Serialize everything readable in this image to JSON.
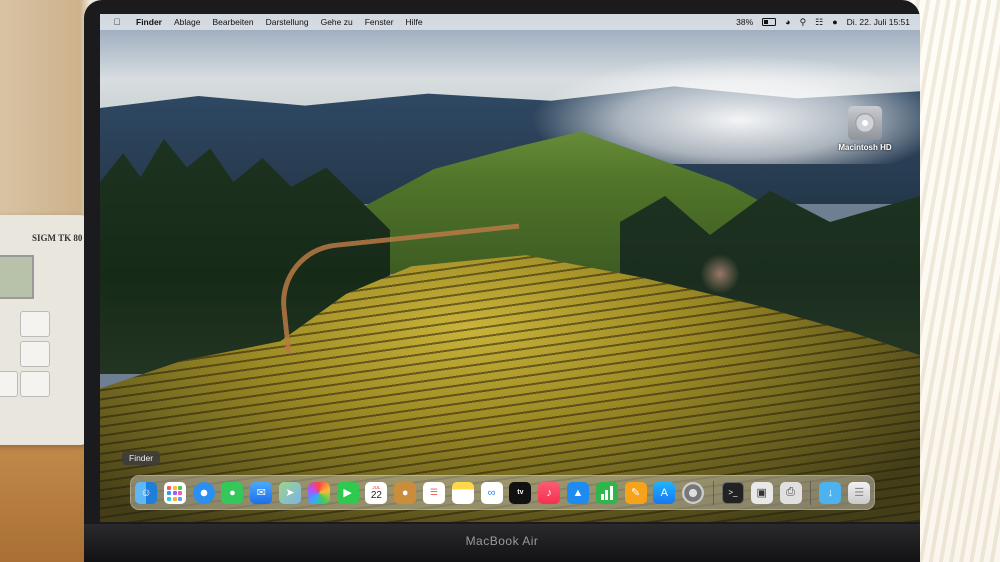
{
  "menubar": {
    "apple_icon": "apple-logo-icon",
    "app_name": "Finder",
    "menus": [
      "Ablage",
      "Bearbeiten",
      "Darstellung",
      "Gehe zu",
      "Fenster",
      "Hilfe"
    ],
    "battery_percent": "38%",
    "date_time": "Di. 22. Juli 15:51"
  },
  "desktop": {
    "drive_label": "Macintosh HD"
  },
  "dock": {
    "tooltip": "Finder",
    "apps": [
      {
        "name": "Finder",
        "icon": "finder-icon"
      },
      {
        "name": "Launchpad",
        "icon": "launchpad-icon"
      },
      {
        "name": "Safari",
        "icon": "safari-icon"
      },
      {
        "name": "Messages",
        "icon": "messages-icon"
      },
      {
        "name": "Mail",
        "icon": "mail-icon"
      },
      {
        "name": "Maps",
        "icon": "maps-icon"
      },
      {
        "name": "Photos",
        "icon": "photos-icon"
      },
      {
        "name": "FaceTime",
        "icon": "facetime-icon"
      },
      {
        "name": "Calendar",
        "icon": "calendar-icon"
      },
      {
        "name": "Contacts",
        "icon": "contacts-icon"
      },
      {
        "name": "Reminders",
        "icon": "reminders-icon"
      },
      {
        "name": "Notes",
        "icon": "notes-icon"
      },
      {
        "name": "Freeform",
        "icon": "freeform-icon"
      },
      {
        "name": "TV",
        "icon": "tv-icon"
      },
      {
        "name": "Music",
        "icon": "music-icon"
      },
      {
        "name": "Keynote",
        "icon": "keynote-icon"
      },
      {
        "name": "Numbers",
        "icon": "numbers-icon"
      },
      {
        "name": "Pages",
        "icon": "pages-icon"
      },
      {
        "name": "App Store",
        "icon": "app-store-icon"
      },
      {
        "name": "System Settings",
        "icon": "system-settings-icon"
      }
    ],
    "calendar_month": "JUL",
    "calendar_day": "22",
    "tv_label": "tv",
    "right_apps": [
      {
        "name": "Terminal",
        "icon": "terminal-icon"
      },
      {
        "name": "Preview",
        "icon": "preview-icon"
      },
      {
        "name": "Printer",
        "icon": "printer-icon"
      },
      {
        "name": "Downloads",
        "icon": "downloads-folder-icon"
      },
      {
        "name": "Trash",
        "icon": "trash-icon"
      }
    ]
  },
  "hardware": {
    "laptop_label": "MacBook Air",
    "phone_brand": "SIGM TK 80"
  },
  "colors": {
    "menubar_bg": "#e6e8ec",
    "dock_bg": "#beb9aa",
    "bezel": "#1b1b1d"
  }
}
